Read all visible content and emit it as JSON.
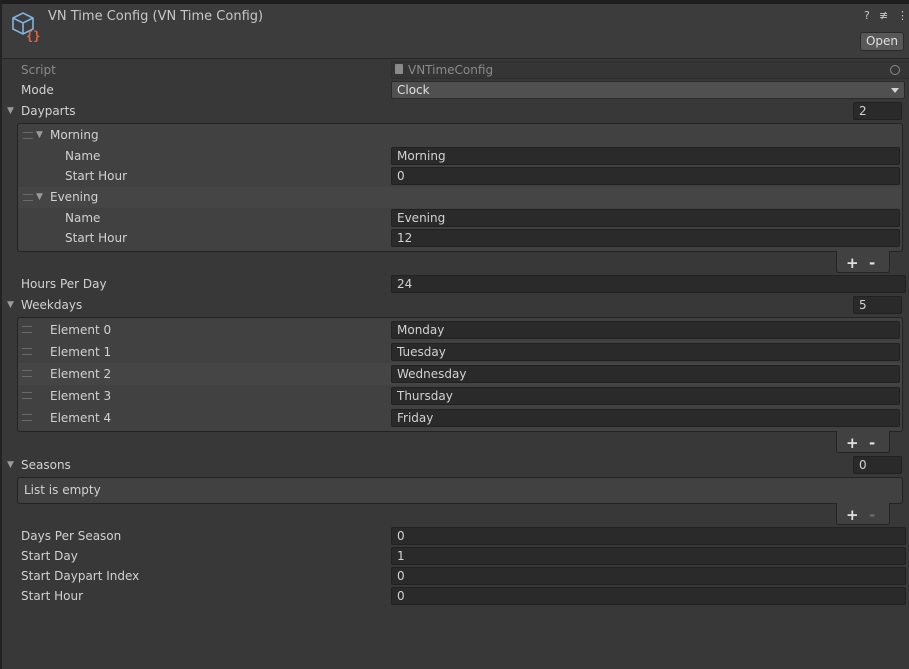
{
  "header": {
    "title": "VN Time Config (VN Time Config)",
    "open_label": "Open",
    "help_icon": "?",
    "settings_icon": "≢",
    "menu_icon": "⋮"
  },
  "script": {
    "label": "Script",
    "value": "VNTimeConfig"
  },
  "mode": {
    "label": "Mode",
    "value": "Clock"
  },
  "dayparts": {
    "label": "Dayparts",
    "count": "2",
    "items": [
      {
        "header": "Morning",
        "name_label": "Name",
        "name": "Morning",
        "start_label": "Start Hour",
        "start": "0"
      },
      {
        "header": "Evening",
        "name_label": "Name",
        "name": "Evening",
        "start_label": "Start Hour",
        "start": "12"
      }
    ]
  },
  "hours_per_day": {
    "label": "Hours Per Day",
    "value": "24"
  },
  "weekdays": {
    "label": "Weekdays",
    "count": "5",
    "items": [
      {
        "label": "Element 0",
        "value": "Monday"
      },
      {
        "label": "Element 1",
        "value": "Tuesday"
      },
      {
        "label": "Element 2",
        "value": "Wednesday"
      },
      {
        "label": "Element 3",
        "value": "Thursday"
      },
      {
        "label": "Element 4",
        "value": "Friday"
      }
    ]
  },
  "seasons": {
    "label": "Seasons",
    "count": "0",
    "empty_text": "List is empty"
  },
  "list_controls": {
    "plus": "+",
    "minus": "-"
  },
  "days_per_season": {
    "label": "Days Per Season",
    "value": "0"
  },
  "start_day": {
    "label": "Start Day",
    "value": "1"
  },
  "start_daypart_index": {
    "label": "Start Daypart Index",
    "value": "0"
  },
  "start_hour": {
    "label": "Start Hour",
    "value": "0"
  }
}
